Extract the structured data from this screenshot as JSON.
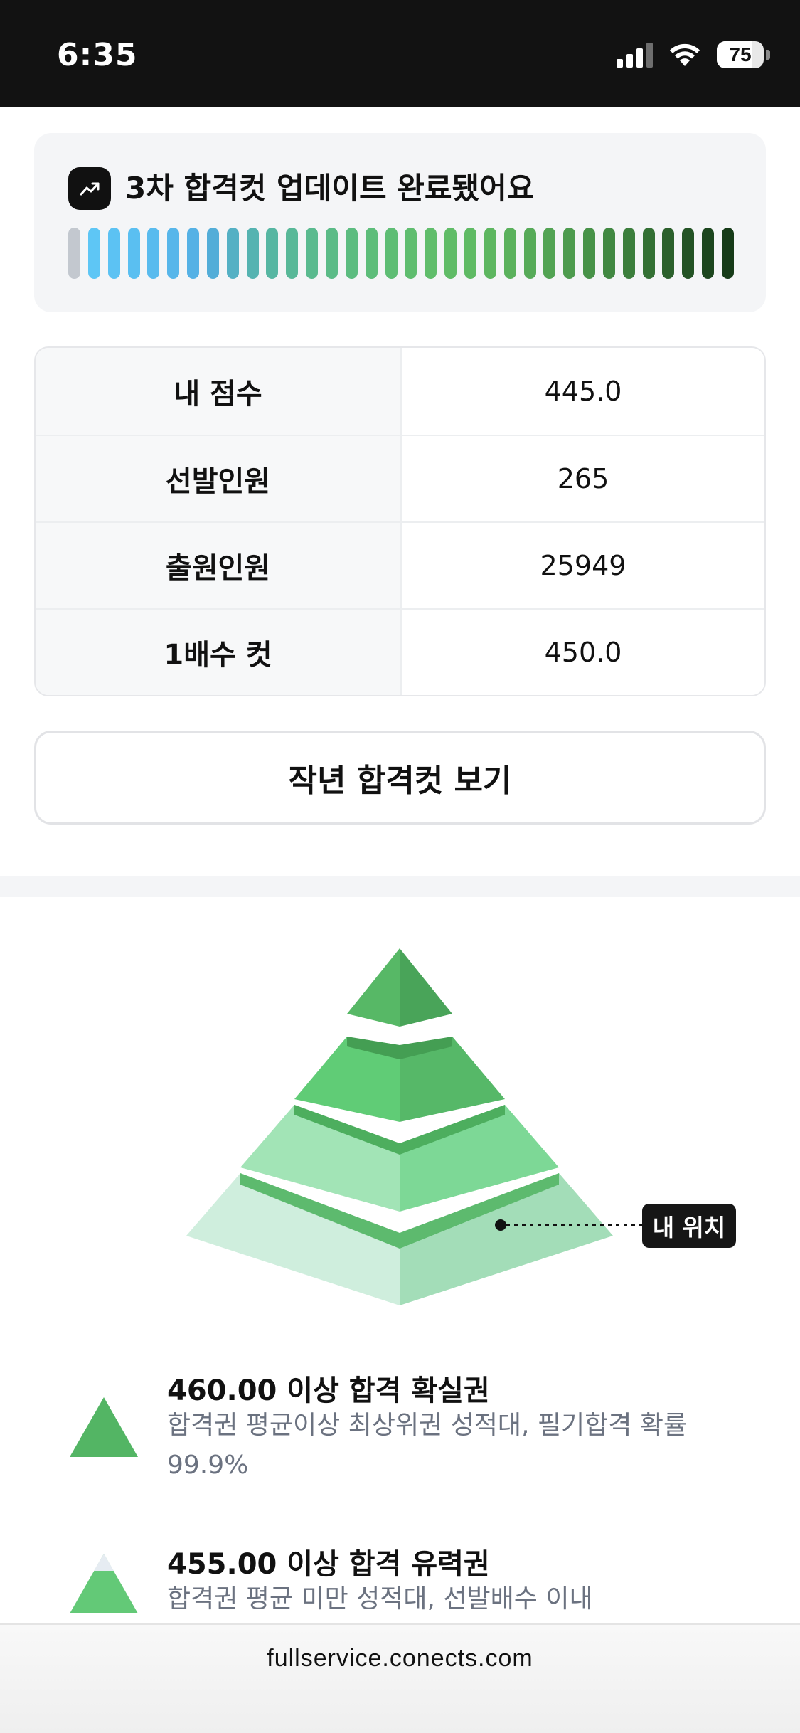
{
  "status_bar": {
    "time": "6:35",
    "battery": "75",
    "battery_level": 0.75
  },
  "update_card": {
    "title": "3차 합격컷 업데이트 완료됐어요",
    "progress_colors": [
      "#c3c8cf",
      "#5ec6f5",
      "#5cc2f3",
      "#5abff1",
      "#59bbee",
      "#57b6ea",
      "#55b1e5",
      "#53add8",
      "#54b0c4",
      "#55b3b1",
      "#56b6a2",
      "#58b898",
      "#5aba8f",
      "#5bbb87",
      "#5cbc80",
      "#5dbd7a",
      "#5ebd74",
      "#5fbd6f",
      "#60bd6b",
      "#60bc67",
      "#5fba64",
      "#5db660",
      "#5ab15c",
      "#56aa58",
      "#52a353",
      "#4d9b4e",
      "#479248",
      "#418842",
      "#3b7e3c",
      "#337034",
      "#2b602c",
      "#235325",
      "#1c461e",
      "#163b18"
    ]
  },
  "score_table": {
    "rows": [
      {
        "label": "내 점수",
        "value": "445.0"
      },
      {
        "label": "선발인원",
        "value": "265"
      },
      {
        "label": "출원인원",
        "value": "25949"
      },
      {
        "label": "1배수 컷",
        "value": "450.0"
      }
    ]
  },
  "buttons": {
    "last_year": "작년 합격컷 보기"
  },
  "pyramid": {
    "my_position": "내 위치"
  },
  "legend": [
    {
      "title": "460.00 이상 합격 확실권",
      "desc": "합격권 평균이상 최상위권 성적대, 필기합격 확률 99.9%"
    },
    {
      "title": "455.00 이상 합격 유력권",
      "desc": "합격권 평균 미만 성적대, 선발배수 이내"
    }
  ],
  "browser": {
    "url": "fullservice.conects.com"
  }
}
